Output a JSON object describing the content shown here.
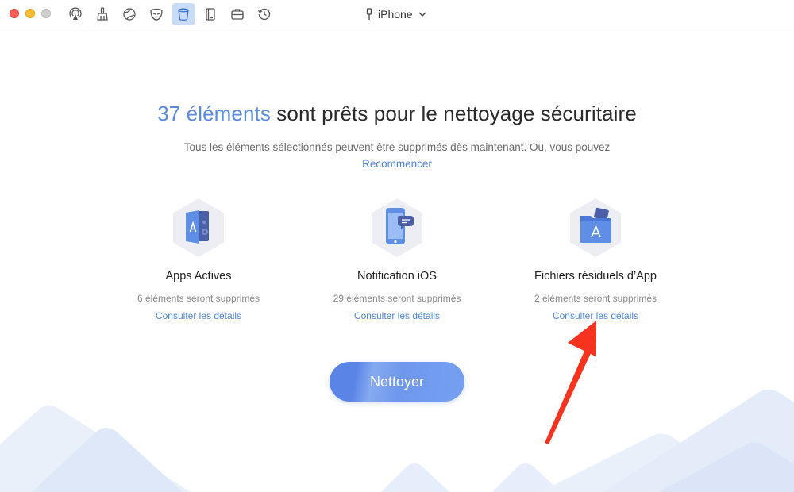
{
  "window": {
    "device_name": "iPhone"
  },
  "toolbar": {
    "tools": [
      {
        "icon": "airplay-icon"
      },
      {
        "icon": "broom-icon"
      },
      {
        "icon": "globe-icon"
      },
      {
        "icon": "mask-icon"
      },
      {
        "icon": "cup-icon",
        "active": true
      },
      {
        "icon": "book-icon"
      },
      {
        "icon": "briefcase-icon"
      },
      {
        "icon": "history-icon"
      }
    ]
  },
  "main": {
    "headline_count": "37 éléments",
    "headline_rest": " sont prêts pour le nettoyage sécuritaire",
    "subtitle": "Tous les éléments sélectionnés peuvent être supprimés dès maintenant. Ou, vous pouvez",
    "restart_link": "Recommencer",
    "cards": [
      {
        "title": "Apps Actives",
        "count": "6 éléments seront supprimés",
        "link": "Consulter les détails",
        "icon": "app-door-icon"
      },
      {
        "title": "Notification iOS",
        "count": "29 éléments seront supprimés",
        "link": "Consulter les détails",
        "icon": "phone-notification-icon"
      },
      {
        "title": "Fichiers résiduels d’App",
        "count": "2 éléments seront supprimés",
        "link": "Consulter les détails",
        "icon": "app-folder-icon"
      }
    ],
    "clean_button": "Nettoyer"
  },
  "colors": {
    "accent": "#5b8be0",
    "link": "#4f86d9",
    "annotation_arrow": "#f5331f"
  }
}
